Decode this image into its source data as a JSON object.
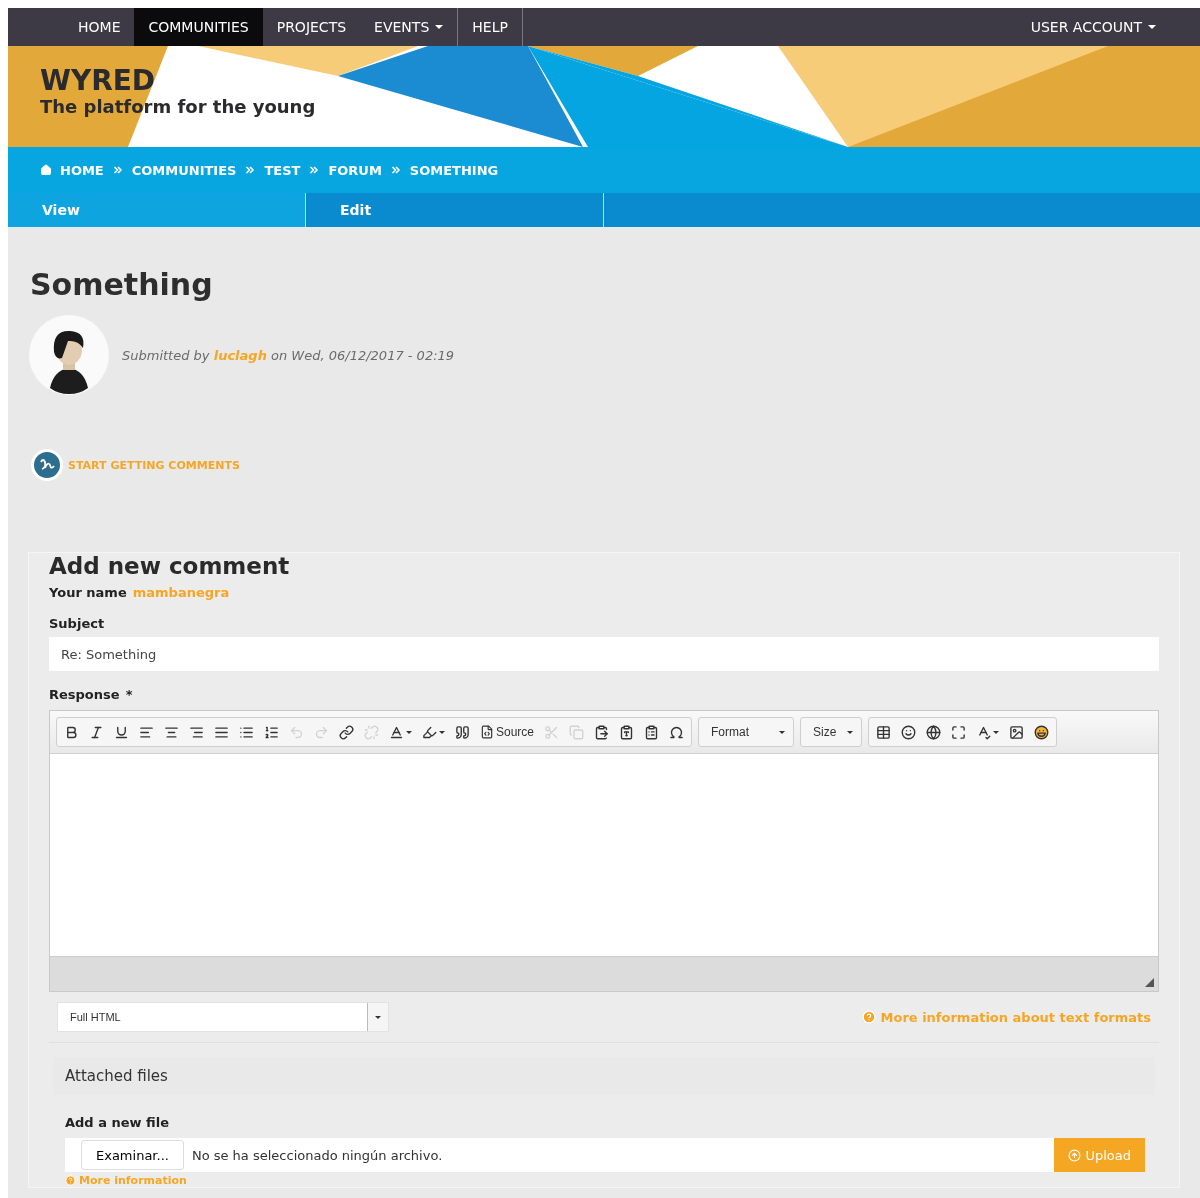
{
  "nav": {
    "items": [
      {
        "label": "HOME",
        "selected": false,
        "dropdown": false
      },
      {
        "label": "COMMUNITIES",
        "selected": true,
        "dropdown": false
      },
      {
        "label": "PROJECTS",
        "selected": false,
        "dropdown": false
      },
      {
        "label": "EVENTS",
        "selected": false,
        "dropdown": true
      },
      {
        "label": "HELP",
        "selected": false,
        "dropdown": false
      }
    ],
    "account": {
      "label": "USER ACCOUNT",
      "dropdown": true
    }
  },
  "brand": {
    "name": "WYRED",
    "tagline": "The platform for the young"
  },
  "breadcrumb": [
    "HOME",
    "COMMUNITIES",
    "TEST",
    "FORUM",
    "SOMETHING"
  ],
  "tabs": [
    {
      "label": "View",
      "selected": true
    },
    {
      "label": "Edit",
      "selected": false
    }
  ],
  "node": {
    "title": "Something",
    "submitted_prefix": "Submitted by",
    "author": "luclagh",
    "submitted_suffix": "on Wed, 06/12/2017 - 02:19"
  },
  "action": {
    "label": "START GETTING COMMENTS"
  },
  "comment_form": {
    "heading": "Add new comment",
    "name_label": "Your name",
    "name_value": "mambanegra",
    "subject": {
      "label": "Subject",
      "value": "Re: Something"
    },
    "response": {
      "label": "Response",
      "required_mark": "*"
    },
    "toolbar": [
      [
        {
          "kind": "icon",
          "disabled": false,
          "menu": false
        },
        {
          "kind": "icon",
          "disabled": false,
          "menu": false
        },
        {
          "kind": "icon",
          "disabled": false,
          "menu": false
        },
        {
          "kind": "icon",
          "disabled": false,
          "menu": false
        },
        {
          "kind": "icon",
          "disabled": false,
          "menu": false
        },
        {
          "kind": "icon",
          "disabled": false,
          "menu": false
        },
        {
          "kind": "icon",
          "disabled": false,
          "menu": false
        },
        {
          "kind": "icon",
          "disabled": false,
          "menu": false
        },
        {
          "kind": "icon",
          "disabled": false,
          "menu": false
        },
        {
          "kind": "icon",
          "disabled": true,
          "menu": false
        },
        {
          "kind": "icon",
          "disabled": true,
          "menu": false
        },
        {
          "kind": "icon",
          "disabled": false,
          "menu": false
        },
        {
          "kind": "icon",
          "disabled": true,
          "menu": false
        },
        {
          "kind": "icon",
          "disabled": false,
          "menu": true
        },
        {
          "kind": "icon",
          "disabled": false,
          "menu": true
        },
        {
          "kind": "icon",
          "disabled": false,
          "menu": false
        },
        {
          "kind": "text",
          "label": "Source",
          "disabled": false,
          "menu": false
        },
        {
          "kind": "icon",
          "disabled": true,
          "menu": false
        },
        {
          "kind": "icon",
          "disabled": true,
          "menu": false
        },
        {
          "kind": "icon",
          "disabled": false,
          "menu": false
        },
        {
          "kind": "icon",
          "disabled": false,
          "menu": false
        },
        {
          "kind": "icon",
          "disabled": false,
          "menu": false
        },
        {
          "kind": "icon",
          "disabled": false,
          "menu": false
        }
      ],
      [
        {
          "kind": "select",
          "label": "Format",
          "disabled": false,
          "menu": true
        }
      ],
      [
        {
          "kind": "select",
          "label": "Size",
          "disabled": false,
          "menu": true
        }
      ],
      [
        {
          "kind": "icon",
          "disabled": false,
          "menu": false
        },
        {
          "kind": "icon",
          "disabled": false,
          "menu": false
        },
        {
          "kind": "icon",
          "disabled": false,
          "menu": false
        },
        {
          "kind": "icon",
          "disabled": false,
          "menu": false
        },
        {
          "kind": "icon",
          "disabled": false,
          "menu": true
        },
        {
          "kind": "icon",
          "disabled": false,
          "menu": false
        },
        {
          "kind": "icon",
          "disabled": false,
          "menu": false
        }
      ]
    ],
    "text_format": {
      "value": "Full HTML"
    },
    "format_help": "More information about text formats",
    "attachments": {
      "title": "Attached files",
      "add_label": "Add a new file",
      "browse_button": "Examinar...",
      "file_status": "No se ha seleccionado ningún archivo.",
      "upload_button": "Upload",
      "help": "More information"
    }
  }
}
